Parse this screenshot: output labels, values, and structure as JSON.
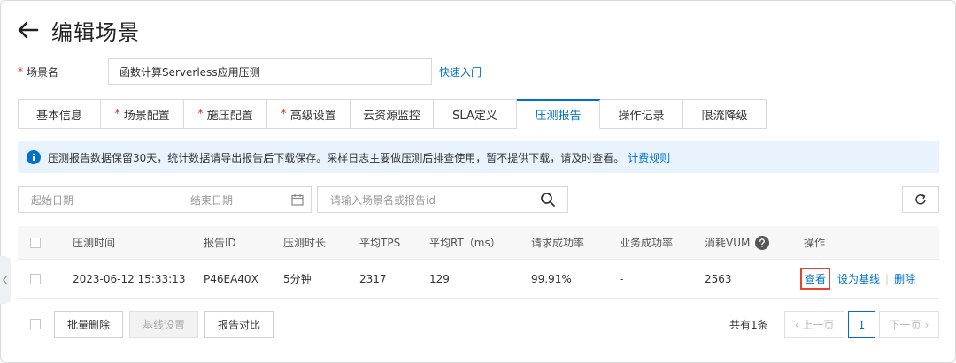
{
  "header": {
    "title": "编辑场景"
  },
  "scene": {
    "label": "场景名",
    "value": "函数计算Serverless应用压测",
    "quick_link": "快速入门"
  },
  "tabs": [
    {
      "label": "基本信息",
      "required": false,
      "active": false
    },
    {
      "label": "场景配置",
      "required": true,
      "active": false
    },
    {
      "label": "施压配置",
      "required": true,
      "active": false
    },
    {
      "label": "高级设置",
      "required": true,
      "active": false
    },
    {
      "label": "云资源监控",
      "required": false,
      "active": false
    },
    {
      "label": "SLA定义",
      "required": false,
      "active": false
    },
    {
      "label": "压测报告",
      "required": false,
      "active": true
    },
    {
      "label": "操作记录",
      "required": false,
      "active": false
    },
    {
      "label": "限流降级",
      "required": false,
      "active": false
    }
  ],
  "notice": {
    "text": "压测报告数据保留30天，统计数据请导出报告后下载保存。采样日志主要做压测后排查使用，暂不提供下载，请及时查看。",
    "link": "计费规则"
  },
  "filters": {
    "start_placeholder": "起始日期",
    "separator": "-",
    "end_placeholder": "结束日期",
    "search_placeholder": "请输入场景名或报告id"
  },
  "table": {
    "columns": [
      "压测时间",
      "报告ID",
      "压测时长",
      "平均TPS",
      "平均RT（ms）",
      "请求成功率",
      "业务成功率",
      "消耗VUM",
      "操作"
    ],
    "rows": [
      {
        "time": "2023-06-12 15:33:13",
        "report_id": "P46EA40X",
        "duration": "5分钟",
        "avg_tps": "2317",
        "avg_rt": "129",
        "req_success": "99.91%",
        "biz_success": "-",
        "vum": "2563",
        "actions": {
          "view": "查看",
          "baseline": "设为基线",
          "delete": "删除"
        }
      }
    ]
  },
  "footer": {
    "batch_delete": "批量删除",
    "baseline_settings": "基线设置",
    "compare": "报告对比",
    "total": "共有1条",
    "prev": "上一页",
    "page": "1",
    "next": "下一页"
  },
  "colors": {
    "accent": "#0070cc",
    "required": "#d93026",
    "highlight": "#e8412c",
    "notice_bg": "#e8f3fd"
  }
}
